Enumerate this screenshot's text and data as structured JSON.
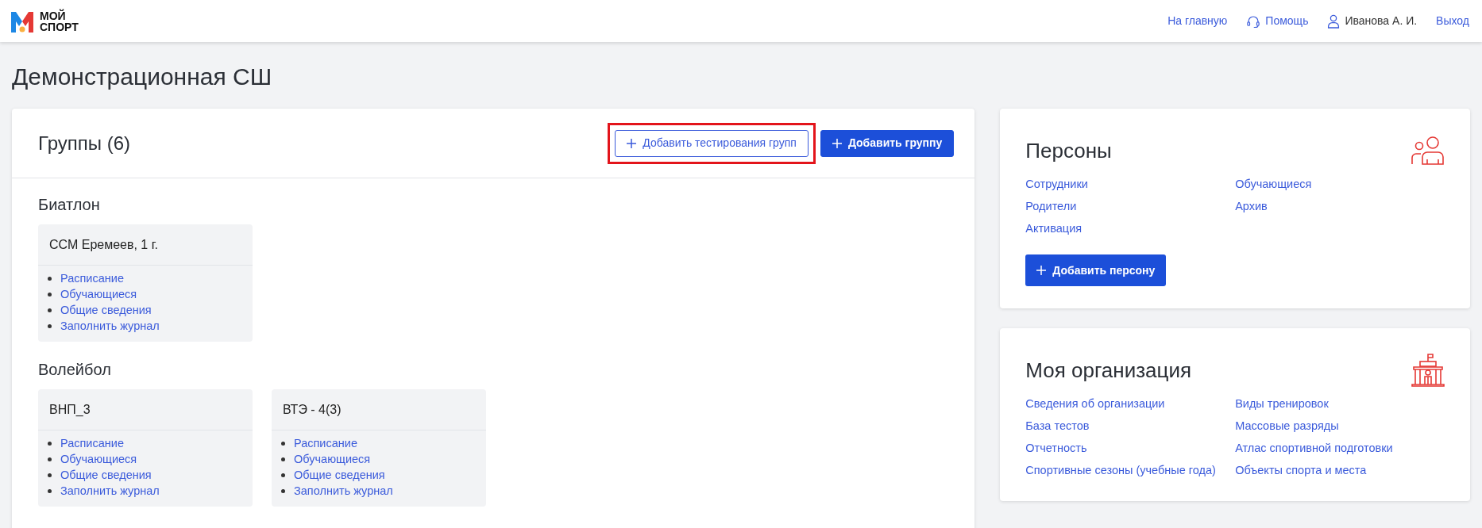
{
  "logo": {
    "line_1": "МОЙ",
    "line_2": "СПОРТ"
  },
  "nav": [
    {
      "kind": "link",
      "label": "На главную"
    },
    {
      "kind": "help",
      "label": "Помощь"
    },
    {
      "kind": "user",
      "label": "Иванова А. И."
    },
    {
      "kind": "link",
      "label": "Выход"
    }
  ],
  "page_title": "Демонстрационная СШ",
  "groups_panel": {
    "title": "Группы (6)",
    "buttons": [
      {
        "kind": "outline",
        "label": "Добавить тестирования групп",
        "highlighted": true
      },
      {
        "kind": "primary",
        "label": "Добавить группу",
        "highlighted": false
      }
    ],
    "sections": [
      {
        "sport": "Биатлон",
        "groups": [
          {
            "name": "ССМ Еремеев, 1 г.",
            "links": [
              "Расписание",
              "Обучающиеся",
              "Общие сведения",
              "Заполнить журнал"
            ]
          }
        ]
      },
      {
        "sport": "Волейбол",
        "groups": [
          {
            "name": "ВНП_3",
            "links": [
              "Расписание",
              "Обучающиеся",
              "Общие сведения",
              "Заполнить журнал"
            ]
          },
          {
            "name": "ВТЭ - 4(3)",
            "links": [
              "Расписание",
              "Обучающиеся",
              "Общие сведения",
              "Заполнить журнал"
            ]
          }
        ]
      }
    ]
  },
  "side_cards": [
    {
      "kind": "people",
      "title": "Персоны",
      "links": [
        "Сотрудники",
        "Обучающиеся",
        "Родители",
        "Архив",
        "Активация"
      ],
      "button": "Добавить персону"
    },
    {
      "kind": "building",
      "title": "Моя организация",
      "links": [
        "Сведения об организации",
        "Виды тренировок",
        "База тестов",
        "Массовые разряды",
        "Отчетность",
        "Атлас спортивной подготовки",
        "Спортивные сезоны (учебные года)",
        "Объекты спорта и места"
      ]
    }
  ]
}
